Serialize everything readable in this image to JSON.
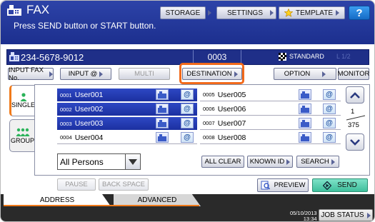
{
  "header": {
    "title": "FAX",
    "message": "Press SEND button or START button.",
    "storage_label": "STORAGE",
    "settings_label": "SETTINGS",
    "template_label": "TEMPLATE",
    "help_label": "?"
  },
  "fax_bar": {
    "number": "234-5678-9012",
    "count": "0003",
    "resolution": "STANDARD",
    "page_indicator": "L 1/2"
  },
  "toolbar": {
    "input_fax_no": "INPUT FAX No.",
    "input_at": "INPUT @",
    "multi": "MULTI",
    "destination": "DESTINATION",
    "option": "OPTION",
    "monitor": "MONITOR"
  },
  "side_tabs": {
    "single": "SINGLE",
    "group": "GROUP"
  },
  "entries": [
    {
      "index": "0001",
      "name": "User001",
      "selected": true
    },
    {
      "index": "0002",
      "name": "User002",
      "selected": true
    },
    {
      "index": "0003",
      "name": "User003",
      "selected": true
    },
    {
      "index": "0004",
      "name": "User004",
      "selected": false
    },
    {
      "index": "0005",
      "name": "User005",
      "selected": false
    },
    {
      "index": "0006",
      "name": "User006",
      "selected": false
    },
    {
      "index": "0007",
      "name": "User007",
      "selected": false
    },
    {
      "index": "0008",
      "name": "User008",
      "selected": false
    }
  ],
  "paging": {
    "current": "1",
    "total": "375"
  },
  "filter": {
    "selected": "All Persons"
  },
  "list_actions": {
    "all_clear": "ALL CLEAR",
    "known_id": "KNOWN ID",
    "search": "SEARCH"
  },
  "controls": {
    "pause": "PAUSE",
    "backspace": "BACK SPACE",
    "preview": "PREVIEW",
    "send": "SEND"
  },
  "tabs": {
    "address": "ADDRESS",
    "advanced": "ADVANCED"
  },
  "status": {
    "date": "05/10/2013",
    "time": "13:34",
    "job_status": "JOB STATUS"
  },
  "colors": {
    "header_blue": "#1c2f8e",
    "selected_row": "#1c30a0",
    "highlight": "#f26a1b",
    "send_green": "#3fbf9c",
    "tab_accent": "#f07a1a"
  }
}
